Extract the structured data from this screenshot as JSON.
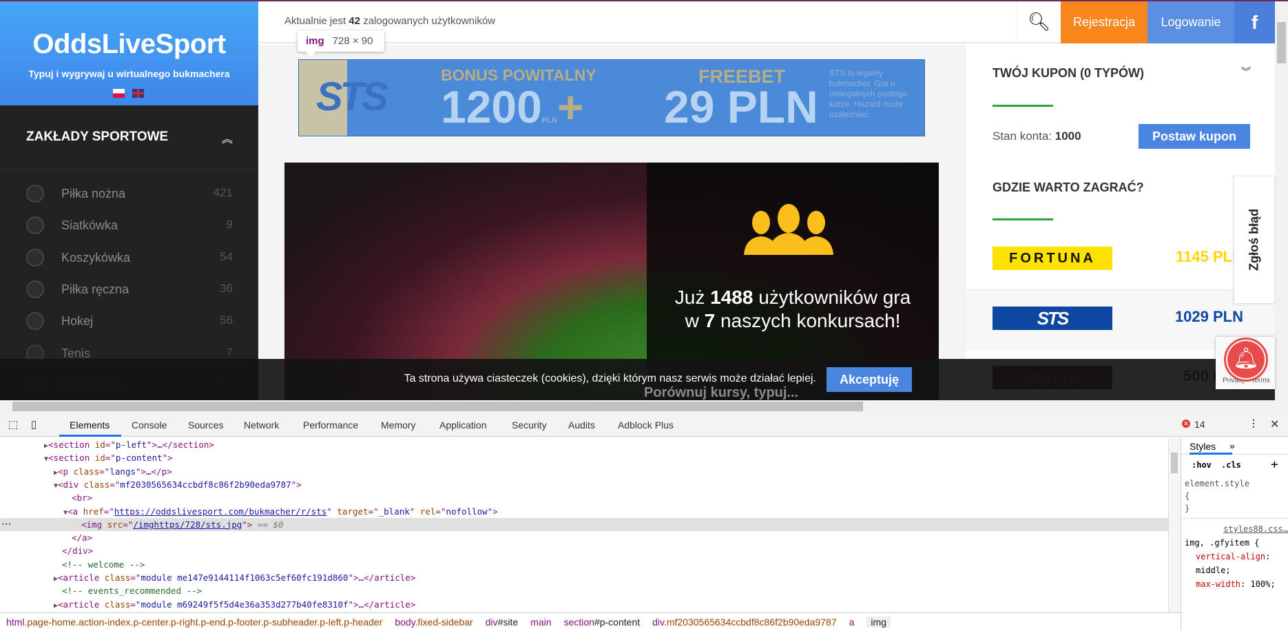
{
  "sidebar": {
    "brand_title": "OddsLiveSport",
    "brand_subtitle": "Typuj i wygrywaj u wirtualnego bukmachera",
    "languages": [
      "pl",
      "en"
    ],
    "section_title": "ZAKŁADY SPORTOWE",
    "items": [
      {
        "label": "Piłka nożna",
        "count": "421",
        "icon": "soccer-ball-icon"
      },
      {
        "label": "Siatkówka",
        "count": "9",
        "icon": "volleyball-icon"
      },
      {
        "label": "Koszykówka",
        "count": "54",
        "icon": "basketball-icon"
      },
      {
        "label": "Piłka ręczna",
        "count": "36",
        "icon": "handball-icon"
      },
      {
        "label": "Hokej",
        "count": "56",
        "icon": "hockey-stick-icon"
      },
      {
        "label": "Tenis",
        "count": "7",
        "icon": "tennis-ball-icon"
      },
      {
        "label": "Boks/MMA",
        "count": "37",
        "icon": "boxing-glove-icon"
      }
    ]
  },
  "header": {
    "online_prefix": "Aktualnie jest",
    "online_count": "42",
    "online_suffix": "zalogowanych użytkowników",
    "register": "Rejestracja",
    "login": "Logowanie",
    "facebook": "f"
  },
  "tooltip": {
    "tag": "img",
    "size": "728 × 90"
  },
  "banner": {
    "logo": "STS",
    "line1": "BONUS POWITALNY",
    "amount1": "1200",
    "currency_small": "PLN",
    "plus": "+",
    "freebet": "FREEBET",
    "amount2": "29 PLN",
    "disclaimer": "STS to legalny bukmacher. Gra u nielegalnych podlega karze. Hazard może uzależniać."
  },
  "hero": {
    "line1_prefix": "Już",
    "users": "1488",
    "line1_suffix": "użytkowników gra",
    "line2_prefix": "w",
    "contests": "7",
    "line2_suffix": "naszych konkursach!",
    "line3": "Porównuj kursy, typuj..."
  },
  "cookie": {
    "text": "Ta strona używa ciasteczek (cookies), dzięki którym nasz serwis może działać lepiej.",
    "accept": "Akceptuję"
  },
  "coupon": {
    "title": "TWÓJ KUPON (0 TYPÓW)",
    "balance_label": "Stan konta:",
    "balance": "1000",
    "place": "Postaw kupon"
  },
  "bookmakers": {
    "title": "GDZIE WARTO ZAGRAĆ?",
    "items": [
      {
        "name": "FORTUNA",
        "bonus": "1145 PLN",
        "color": "#ffd500"
      },
      {
        "name": "STS",
        "bonus": "1029 PLN",
        "color": "#0d47a1"
      },
      {
        "name": "Betclic",
        "bonus": "500 PLN",
        "color": "#5a0000"
      }
    ]
  },
  "report": "Zgłoś błąd",
  "recaptcha": "Privacy - Terms",
  "devtools": {
    "tabs": [
      "Elements",
      "Console",
      "Sources",
      "Network",
      "Performance",
      "Memory",
      "Application",
      "Security",
      "Audits",
      "Adblock Plus"
    ],
    "errors": "14",
    "code": [
      {
        "indent": 0,
        "arrow": "▶",
        "seg": [
          [
            "tag",
            "<section "
          ],
          [
            "at",
            "id"
          ],
          [
            "tag",
            "=\""
          ],
          [
            "av",
            "p-left"
          ],
          [
            "tag",
            "\">"
          ],
          [
            "pl",
            "…"
          ],
          [
            "tag",
            "</section>"
          ]
        ]
      },
      {
        "indent": 0,
        "arrow": "▼",
        "seg": [
          [
            "tag",
            "<section "
          ],
          [
            "at",
            "id"
          ],
          [
            "tag",
            "=\""
          ],
          [
            "av",
            "p-content"
          ],
          [
            "tag",
            "\">"
          ]
        ]
      },
      {
        "indent": 1,
        "arrow": "▶",
        "seg": [
          [
            "tag",
            "<p "
          ],
          [
            "at",
            "class"
          ],
          [
            "tag",
            "=\""
          ],
          [
            "av",
            "langs"
          ],
          [
            "tag",
            "\">"
          ],
          [
            "pl",
            "…"
          ],
          [
            "tag",
            "</p>"
          ]
        ]
      },
      {
        "indent": 1,
        "arrow": "▼",
        "seg": [
          [
            "tag",
            "<div "
          ],
          [
            "at",
            "class"
          ],
          [
            "tag",
            "=\""
          ],
          [
            "av",
            "mf2030565634ccbdf8c86f2b90eda9787"
          ],
          [
            "tag",
            "\">"
          ]
        ]
      },
      {
        "indent": 2,
        "arrow": "",
        "seg": [
          [
            "tag",
            "<br>"
          ]
        ]
      },
      {
        "indent": 2,
        "arrow": "▼",
        "seg": [
          [
            "tag",
            "<a "
          ],
          [
            "at",
            "href"
          ],
          [
            "tag",
            "=\""
          ],
          [
            "lnk",
            "https://oddslivesport.com/bukmacher/r/sts"
          ],
          [
            "tag",
            "\" "
          ],
          [
            "at",
            "target"
          ],
          [
            "tag",
            "=\""
          ],
          [
            "av",
            "_blank"
          ],
          [
            "tag",
            "\" "
          ],
          [
            "at",
            "rel"
          ],
          [
            "tag",
            "=\""
          ],
          [
            "av",
            "nofollow"
          ],
          [
            "tag",
            "\">"
          ]
        ]
      },
      {
        "indent": 3,
        "arrow": "",
        "sel": true,
        "seg": [
          [
            "tag",
            "<img "
          ],
          [
            "at",
            "src"
          ],
          [
            "tag",
            "=\""
          ],
          [
            "lnk",
            "/imghttps/728/sts.jpg"
          ],
          [
            "tag",
            "\">"
          ],
          [
            "gr",
            " == $0"
          ]
        ]
      },
      {
        "indent": 2,
        "arrow": "",
        "seg": [
          [
            "tag",
            "</a>"
          ]
        ]
      },
      {
        "indent": 1,
        "arrow": "",
        "seg": [
          [
            "tag",
            "</div>"
          ]
        ]
      },
      {
        "indent": 1,
        "arrow": "",
        "seg": [
          [
            "cm",
            "<!-- welcome -->"
          ]
        ]
      },
      {
        "indent": 1,
        "arrow": "▶",
        "seg": [
          [
            "tag",
            "<article "
          ],
          [
            "at",
            "class"
          ],
          [
            "tag",
            "=\""
          ],
          [
            "av",
            "module me147e9144114f1063c5ef60fc191d860"
          ],
          [
            "tag",
            "\">"
          ],
          [
            "pl",
            "…"
          ],
          [
            "tag",
            "</article>"
          ]
        ]
      },
      {
        "indent": 1,
        "arrow": "",
        "seg": [
          [
            "cm",
            "<!-- events_recommended -->"
          ]
        ]
      },
      {
        "indent": 1,
        "arrow": "▶",
        "seg": [
          [
            "tag",
            "<article "
          ],
          [
            "at",
            "class"
          ],
          [
            "tag",
            "=\""
          ],
          [
            "av",
            "module m69249f5f5d4e36a353d277b40fe8310f"
          ],
          [
            "tag",
            "\">"
          ],
          [
            "pl",
            "…"
          ],
          [
            "tag",
            "</article>"
          ]
        ]
      }
    ],
    "styles": {
      "tab": "Styles",
      "more": "»",
      "hov": ":hov",
      "cls": ".cls",
      "add": "+",
      "element_style": "element.style",
      "open": "{",
      "close": "}",
      "source": "styles88.css…",
      "selector": "img, .gfyitem {",
      "p1": "vertical-align",
      "v1": "middle;",
      "p2": "max-width",
      "v2": "100%;"
    },
    "breadcrumb": [
      [
        "bc-tag",
        "html"
      ],
      [
        "bc-cls",
        ".page-home.action-index.p-center.p-right.p-end.p-footer.p-subheader.p-left.p-header"
      ],
      [
        "bc-tag",
        "body"
      ],
      [
        "bc-cls",
        ".fixed-sidebar"
      ],
      [
        "bc-tag",
        "div"
      ],
      [
        "pl",
        "#site"
      ],
      [
        "bc-tag",
        "main"
      ],
      [
        "bc-tag",
        "section"
      ],
      [
        "pl",
        "#p-content"
      ],
      [
        "bc-tag",
        "div"
      ],
      [
        "bc-cls",
        ".mf2030565634ccbdf8c86f2b90eda9787"
      ],
      [
        "bc-tag",
        "a"
      ],
      [
        "pl",
        "img"
      ]
    ]
  }
}
